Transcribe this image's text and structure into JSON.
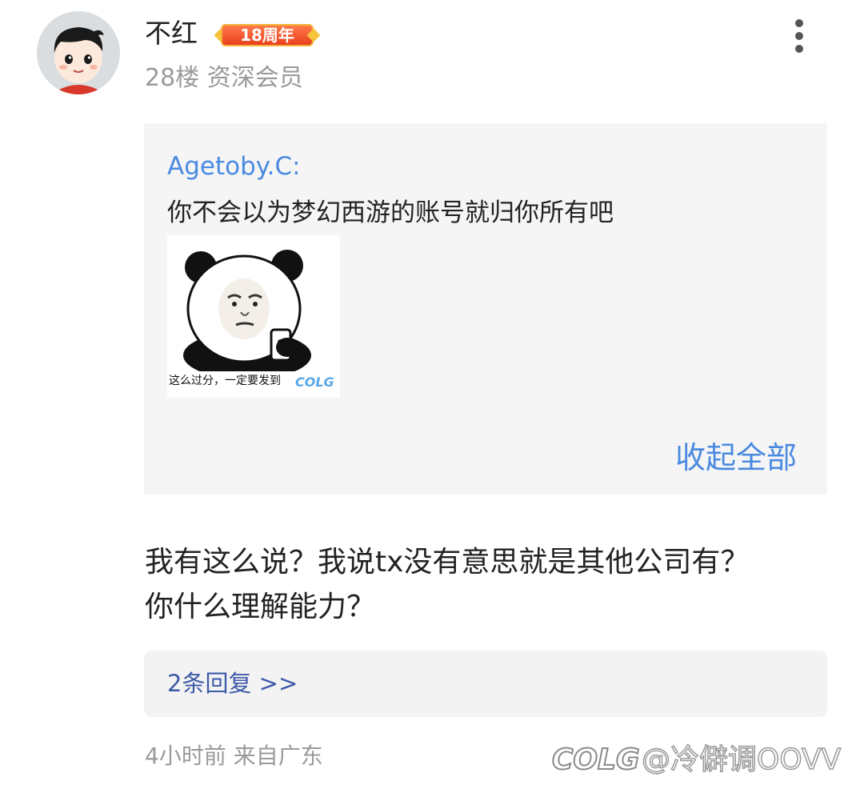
{
  "post": {
    "username": "不红",
    "badge_label": "18周年",
    "floor": "28楼",
    "member_level": "资深会员",
    "more_icon": "vertical-ellipsis-icon"
  },
  "quote": {
    "author": "Agetoby.C:",
    "text": "你不会以为梦幻西游的账号就归你所有吧",
    "sticker_caption": "这么过分，一定要发到",
    "sticker_logo": "COLG",
    "collapse_label": "收起全部"
  },
  "comment": {
    "line1": "我有这么说？我说tx没有意思就是其他公司有？",
    "line2": "你什么理解能力？"
  },
  "replies": {
    "label": "2条回复 >>"
  },
  "footer": {
    "time_and_location": "4小时前 来自广东"
  },
  "watermark": {
    "logo": "COLG",
    "text": "@冷僻调OOVV"
  },
  "colors": {
    "link_blue": "#4a8ae0",
    "reply_link": "#3d5aa8",
    "meta_gray": "#9a9a9a",
    "quote_bg": "#f5f5f5",
    "badge_red": "#e8401e"
  }
}
